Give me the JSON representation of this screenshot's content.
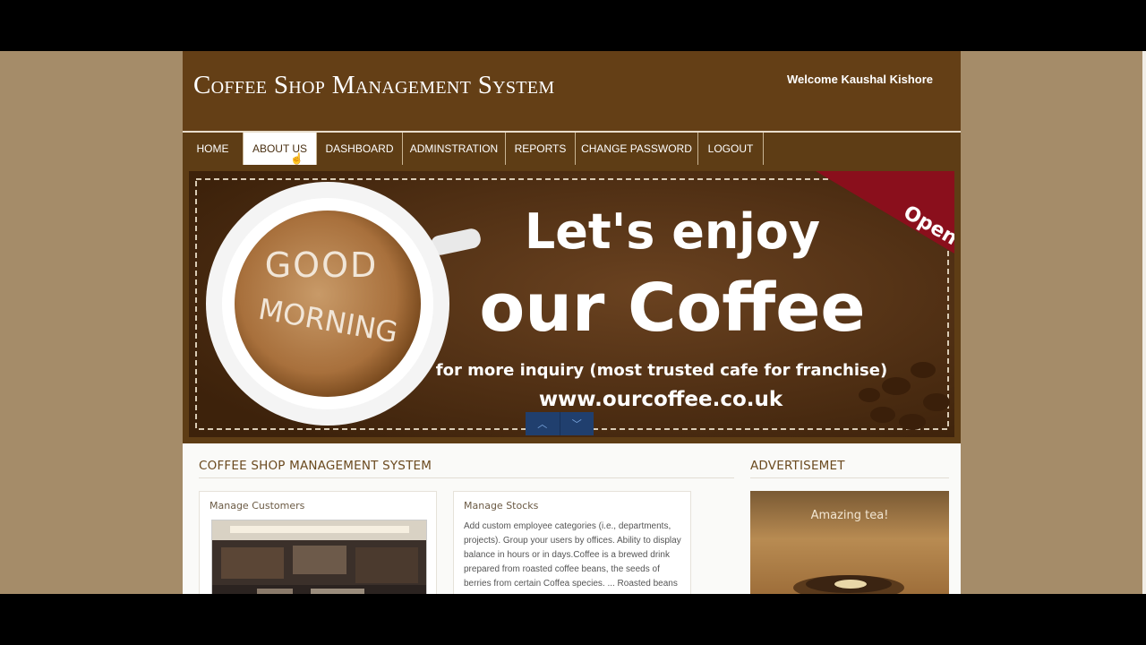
{
  "site": {
    "title": "Coffee Shop Management System",
    "welcome": "Welcome Kaushal Kishore"
  },
  "nav": {
    "items": [
      {
        "label": "HOME",
        "active": false
      },
      {
        "label": "ABOUT US",
        "active": true
      },
      {
        "label": "DASHBOARD",
        "active": false
      },
      {
        "label": "ADMINSTRATION",
        "active": false
      },
      {
        "label": "REPORTS",
        "active": false
      },
      {
        "label": "CHANGE PASSWORD",
        "active": false
      },
      {
        "label": "LOGOUT",
        "active": false
      }
    ]
  },
  "banner": {
    "cup_text_line1": "GOOD",
    "cup_text_line2": "MORNING",
    "headline_line1": "Let's enjoy",
    "headline_line2": "our Coffee",
    "subline": "for more inquiry (most trusted cafe for franchise)",
    "url": "www.ourcoffee.co.uk",
    "ribbon": "Open",
    "prev_icon": "chevron-up-icon",
    "next_icon": "chevron-down-icon"
  },
  "main": {
    "heading": "COFFEE SHOP MANAGEMENT SYSTEM",
    "cards": [
      {
        "title": "Manage Customers"
      },
      {
        "title": "Manage Stocks",
        "text": "Add custom employee categories (i.e., departments, projects). Group your users by offices. Ability to display balance in hours or in days.Coffee is a brewed drink prepared from roasted coffee beans, the seeds of berries from certain Coffea species. ... Roasted beans"
      }
    ]
  },
  "sidebar": {
    "heading": "ADVERTISEMET",
    "ad_text": "Amazing tea!"
  },
  "colors": {
    "header_bg": "#643f16",
    "page_bg": "#a58c69",
    "nav_active_bg": "#ffffff",
    "slider_btn": "#203f6e"
  }
}
